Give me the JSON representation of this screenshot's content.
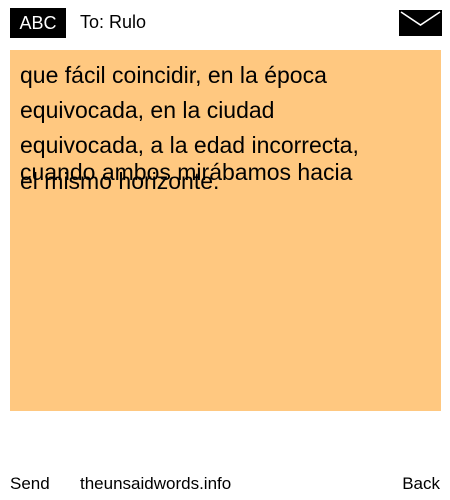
{
  "header": {
    "input_mode": "ABC",
    "recipient_label": "To: Rulo",
    "envelope_icon": "envelope-icon"
  },
  "message": {
    "lines": [
      "que fácil coincidir, en la época",
      "equivocada, en la ciudad",
      "equivocada, a la edad incorrecta,",
      "cuando ambos mirábamos hacia",
      "el mismo horizonte."
    ],
    "background_color": "#ffc880"
  },
  "footer": {
    "send_label": "Send",
    "site_label": "theunsaidwords.info",
    "back_label": "Back"
  }
}
